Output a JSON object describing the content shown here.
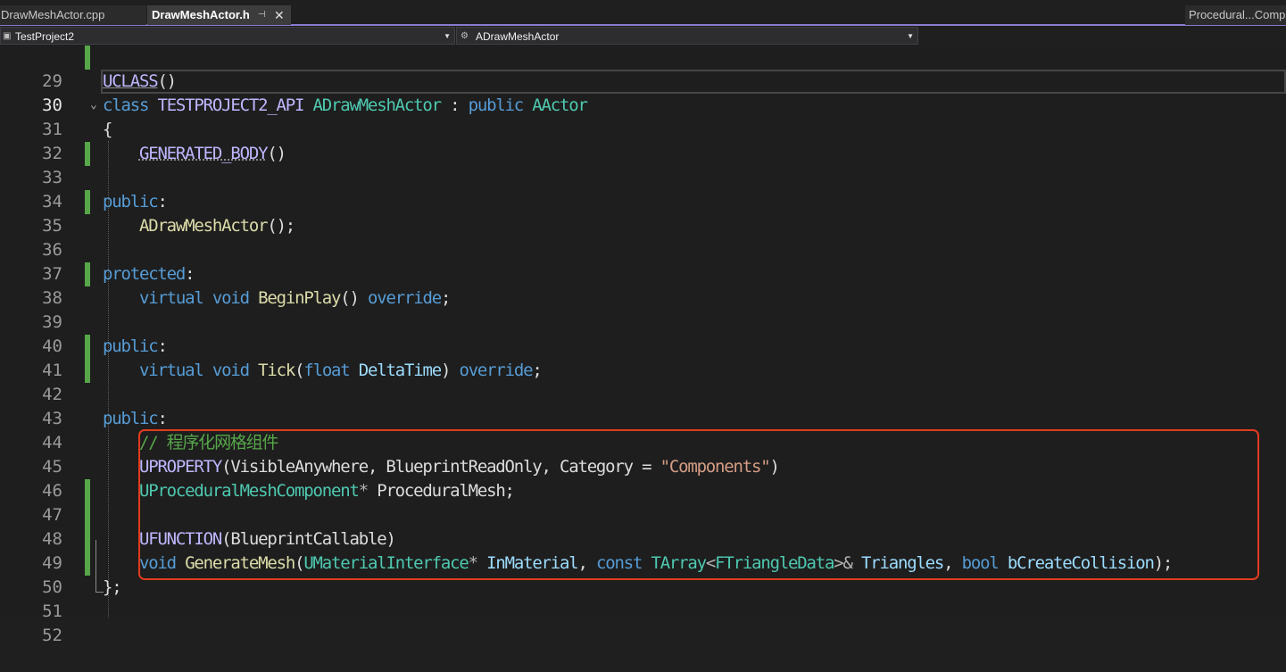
{
  "tabs": {
    "inactive": "DrawMeshActor.cpp",
    "active": "DrawMeshActor.h",
    "right": "Procedural...Comp"
  },
  "nav": {
    "project": "TestProject2",
    "class": "ADrawMeshActor"
  },
  "code": {
    "l29": {
      "ln": "29"
    },
    "l30": {
      "ln": "30",
      "macro": "UCLASS",
      "paren": "()"
    },
    "l31": {
      "ln": "31",
      "kw_class": "class",
      "api": "TESTPROJECT2_API",
      "name": "ADrawMeshActor",
      "colon": " : ",
      "kw_public": "public",
      "base": "AActor"
    },
    "l32": {
      "ln": "32",
      "brace": "{"
    },
    "l33": {
      "ln": "33",
      "macro": "GENERATED_BODY",
      "paren": "()"
    },
    "l34": {
      "ln": "34"
    },
    "l35": {
      "ln": "35",
      "kw": "public",
      "colon": ":"
    },
    "l36": {
      "ln": "36",
      "fn": "ADrawMeshActor",
      "rest": "();"
    },
    "l37": {
      "ln": "37"
    },
    "l38": {
      "ln": "38",
      "kw": "protected",
      "colon": ":"
    },
    "l39": {
      "ln": "39",
      "kw_virtual": "virtual",
      "kw_void": "void",
      "fn": "BeginPlay",
      "paren": "()",
      "kw_override": "override",
      "semi": ";"
    },
    "l40": {
      "ln": "40"
    },
    "l41": {
      "ln": "41",
      "kw": "public",
      "colon": ":"
    },
    "l42": {
      "ln": "42",
      "kw_virtual": "virtual",
      "kw_void": "void",
      "fn": "Tick",
      "open": "(",
      "kw_float": "float",
      "param": "DeltaTime",
      "close": ")",
      "kw_override": "override",
      "semi": ";"
    },
    "l43": {
      "ln": "43"
    },
    "l44": {
      "ln": "44",
      "kw": "public",
      "colon": ":"
    },
    "l45": {
      "ln": "45",
      "comment": "// 程序化网格组件"
    },
    "l46": {
      "ln": "46",
      "macro": "UPROPERTY",
      "open": "(",
      "args": "VisibleAnywhere, BlueprintReadOnly, Category = ",
      "str": "\"Components\"",
      "close": ")"
    },
    "l47": {
      "ln": "47",
      "type": "UProceduralMeshComponent",
      "star": "*",
      "name": " ProceduralMesh;"
    },
    "l48": {
      "ln": "48"
    },
    "l49": {
      "ln": "49",
      "macro": "UFUNCTION",
      "open": "(",
      "args": "BlueprintCallable",
      "close": ")"
    },
    "l50": {
      "ln": "50",
      "kw_void": "void",
      "fn": "GenerateMesh",
      "open": "(",
      "type1": "UMaterialInterface",
      "star": "*",
      "p1": "InMaterial",
      "comma1": ", ",
      "kw_const": "const",
      "type2": "TArray",
      "lt": "<",
      "type3": "FTriangleData",
      "gt": ">",
      "amp": "&",
      "p2": "Triangles",
      "comma2": ", ",
      "kw_bool": "bool",
      "p3": "bCreateCollision",
      "close": ");"
    },
    "l51": {
      "ln": "51",
      "text": "};"
    },
    "l52": {
      "ln": "52"
    }
  }
}
